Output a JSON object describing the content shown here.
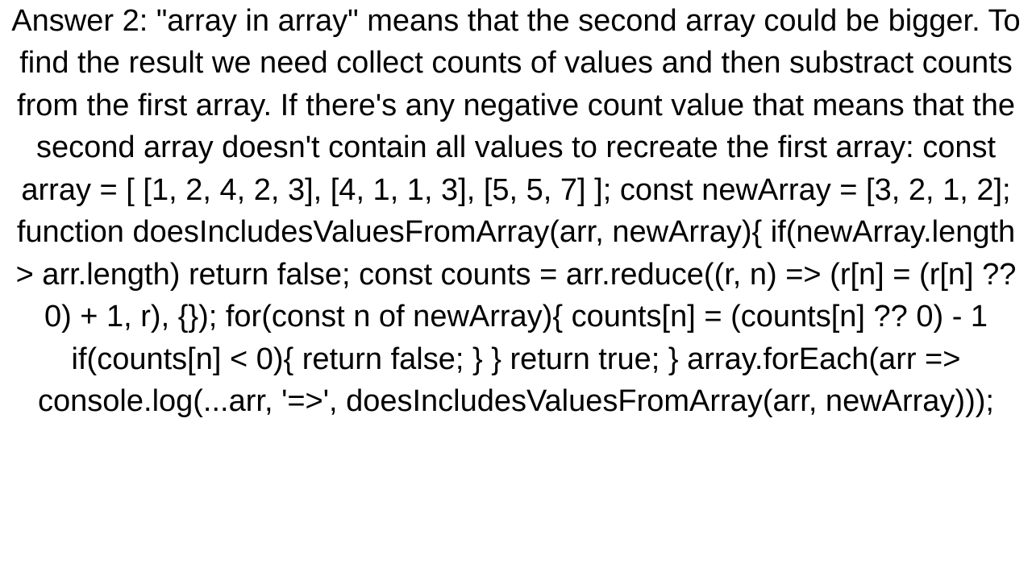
{
  "main": {
    "text": "Answer 2: \"array in array\" means that the second array could be bigger. To find the result we need collect counts of values and then substract counts from the first array. If there's any negative count value that means that the second array doesn't contain all values to recreate the first array:   const array = [   [1, 2, 4, 2, 3],   [4, 1, 1, 3],   [5, 5, 7] ];  const newArray = [3, 2, 1, 2];  function doesIncludesValuesFromArray(arr, newArray){   if(newArray.length > arr.length) return false;   const counts = arr.reduce((r, n) => (r[n] = (r[n] ?? 0) + 1, r), {});   for(const n of newArray){     counts[n] = (counts[n] ?? 0) - 1     if(counts[n] < 0){       return false;     }   }   return true; }  array.forEach(arr => console.log(...arr, '=>', doesIncludesValuesFromArray(arr, newArray)));"
  }
}
